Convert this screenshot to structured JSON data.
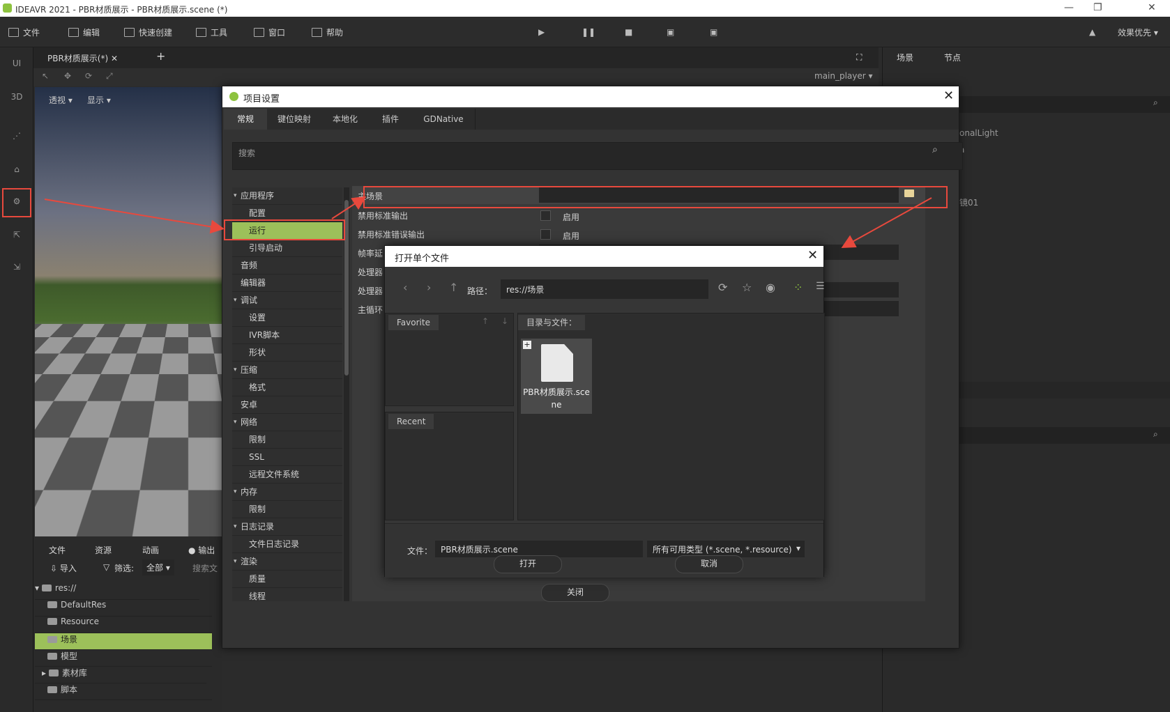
{
  "app": {
    "title": "IDEAVR 2021 - PBR材质展示 - PBR材质展示.scene (*)"
  },
  "menu": {
    "file": "文件",
    "edit": "编辑",
    "quick_create": "快速创建",
    "tools": "工具",
    "window": "窗口",
    "help": "帮助",
    "quality": "效果优先"
  },
  "left_toolbar": {
    "ui": "UI",
    "three_d": "3D"
  },
  "viewport": {
    "tab_label": "PBR材质展示(*)",
    "perspective": "透视",
    "display": "显示",
    "player": "main_player"
  },
  "right_panel": {
    "tab_scene": "场景",
    "tab_node": "节点",
    "node_1": "onalLight",
    "node_2": "a",
    "node_3": "镜01"
  },
  "bottom_dock": {
    "tab_file": "文件",
    "tab_resource": "资源",
    "tab_anim": "动画",
    "tab_output": "输出",
    "import": "导入",
    "filter_label": "筛选:",
    "filter_value": "全部",
    "search_placeholder": "搜索文",
    "tree": [
      "res://",
      "DefaultRes",
      "Resource",
      "场景",
      "模型",
      "素材库",
      "脚本"
    ]
  },
  "project_settings": {
    "title": "项目设置",
    "tabs": [
      "常规",
      "键位映射",
      "本地化",
      "插件",
      "GDNative"
    ],
    "search_placeholder": "搜索",
    "categories": [
      {
        "label": "应用程序",
        "level": "top"
      },
      {
        "label": "配置",
        "level": "sub"
      },
      {
        "label": "运行",
        "level": "sub",
        "selected": true
      },
      {
        "label": "引导启动",
        "level": "sub"
      },
      {
        "label": "音频",
        "level": "plain"
      },
      {
        "label": "编辑器",
        "level": "plain"
      },
      {
        "label": "调试",
        "level": "top"
      },
      {
        "label": "设置",
        "level": "sub"
      },
      {
        "label": "IVR脚本",
        "level": "sub"
      },
      {
        "label": "形状",
        "level": "sub"
      },
      {
        "label": "压缩",
        "level": "top"
      },
      {
        "label": "格式",
        "level": "sub"
      },
      {
        "label": "安卓",
        "level": "plain"
      },
      {
        "label": "网络",
        "level": "top"
      },
      {
        "label": "限制",
        "level": "sub"
      },
      {
        "label": "SSL",
        "level": "sub"
      },
      {
        "label": "远程文件系统",
        "level": "sub"
      },
      {
        "label": "内存",
        "level": "top"
      },
      {
        "label": "限制",
        "level": "sub"
      },
      {
        "label": "日志记录",
        "level": "top"
      },
      {
        "label": "文件日志记录",
        "level": "sub"
      },
      {
        "label": "渲染",
        "level": "top"
      },
      {
        "label": "质量",
        "level": "sub"
      },
      {
        "label": "线程",
        "level": "sub"
      }
    ],
    "props": {
      "main_scene": "主场景",
      "disable_stdout": "禁用标准输出",
      "disable_stderr": "禁用标准错误输出",
      "enable": "启用",
      "frame_delay": "帧率延",
      "processor1": "处理器",
      "processor2": "处理器",
      "main_loop": "主循环"
    },
    "close": "关闭"
  },
  "file_dialog": {
    "title": "打开单个文件",
    "path_label": "路径：",
    "path_value": "res://场景",
    "favorite": "Favorite",
    "recent": "Recent",
    "dirs_files": "目录与文件：",
    "file_name": "PBR材质展示.scene",
    "file_label_display": "PBR材质展示.sce ne",
    "file_field_label": "文件：",
    "filter": "所有可用类型 (*.scene, *.resource)",
    "open": "打开",
    "cancel": "取消"
  },
  "colors": {
    "accent": "#9cc05a",
    "highlight": "#e8493d"
  }
}
